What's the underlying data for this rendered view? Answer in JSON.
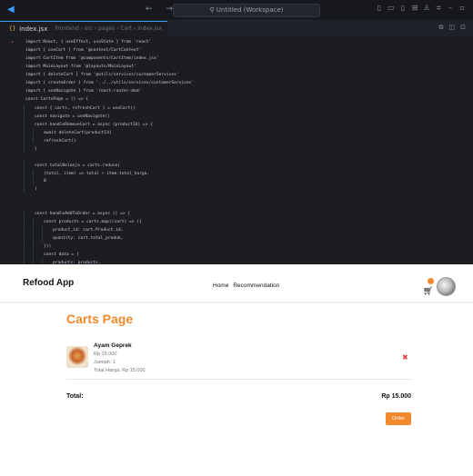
{
  "ide": {
    "window_title": "Untitled (Workspace)",
    "tab": {
      "filename": "index.jsx",
      "path": "Frontend › src › pages › Cart › index.jsx"
    },
    "code_lines": [
      "import React, { useEffect, useState } from 'react'",
      "import { useCart } from '@context/CartContext'",
      "import CartItem from '@components/CartItem/index.jsx'",
      "import MainLayout from '@layouts/MainLayout'",
      "import { deleteCart } from '@utils/services/customerServices'",
      "import { createOrder } from '../../utils/services/customerServices'",
      "import { useNavigate } from 'react-router-dom'",
      "const CartsPage = () => {",
      "    const { carts, refreshCart } = useCart()",
      "    const navigate = useNavigate()",
      "    const handleRemoveCart = async (productId) => {",
      "        await deleteCart(productId)",
      "        refreshCart()",
      "    }",
      "",
      "    const totalBelanja = carts.reduce(",
      "        (total, item) => total + item.total_harga,",
      "        0",
      "    )",
      "",
      "",
      "    const handleAddToOrder = async () => {",
      "        const products = carts.map((cart) => ({",
      "            product_id: cart.Product.id,",
      "            quantity: cart.total_produk,",
      "        }))",
      "        const data = {",
      "            products: products,",
      "            total_harga: totalBelanja,",
      "        }"
    ]
  },
  "app": {
    "brand": "Refood App",
    "nav_links": [
      "Home",
      "Recommendation"
    ],
    "page_title": "Carts Page",
    "item": {
      "name": "Ayam Geprek",
      "price": "Rp 15.000",
      "quantity": "Jumlah: 1",
      "total": "Total Harga: Rp 15.000"
    },
    "total_label": "Total:",
    "total_value": "Rp 15.000",
    "order_button": "Order",
    "colors": {
      "accent": "#f08a2c",
      "danger": "#e23b3b"
    }
  }
}
